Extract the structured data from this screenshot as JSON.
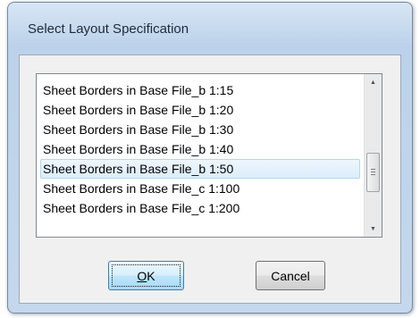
{
  "dialog": {
    "title": "Select Layout Specification"
  },
  "list": {
    "items": [
      {
        "label": "Sheet Borders in Base File_b 1:15",
        "selected": false
      },
      {
        "label": "Sheet Borders in Base File_b 1:20",
        "selected": false
      },
      {
        "label": "Sheet Borders in Base File_b 1:30",
        "selected": false
      },
      {
        "label": "Sheet Borders in Base File_b 1:40",
        "selected": false
      },
      {
        "label": "Sheet Borders in Base File_b 1:50",
        "selected": true
      },
      {
        "label": "Sheet Borders in Base File_c 1:100",
        "selected": false
      },
      {
        "label": "Sheet Borders in Base File_c 1:200",
        "selected": false
      }
    ],
    "scroll_up_icon": "scroll-up-arrow",
    "scroll_down_icon": "scroll-down-arrow"
  },
  "buttons": {
    "ok": {
      "mnemonic": "O",
      "rest": "K"
    },
    "cancel": {
      "label": "Cancel"
    }
  },
  "colors": {
    "selection_border": "#b5d6f1",
    "selection_fill": "#dcedfb",
    "default_button_border": "#3c7fb1"
  }
}
